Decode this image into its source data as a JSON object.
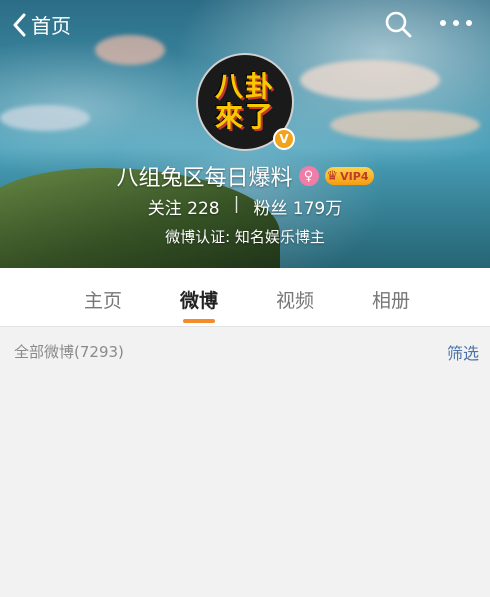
{
  "nav": {
    "back_label": "首页"
  },
  "profile": {
    "avatar_text_line1": "八卦",
    "avatar_text_line2": "來了",
    "verified_mark": "V",
    "name": "八组兔区每日爆料",
    "female_badge": "♀",
    "vip_label": "VIP4",
    "following_label": "关注",
    "following_count": "228",
    "followers_label": "粉丝",
    "followers_count": "179万",
    "certification": "微博认证: 知名娱乐博主"
  },
  "tabs": [
    {
      "label": "主页",
      "active": false
    },
    {
      "label": "微博",
      "active": true
    },
    {
      "label": "视频",
      "active": false
    },
    {
      "label": "相册",
      "active": false
    }
  ],
  "feed": {
    "all_posts_label": "全部微博(7293)",
    "filter_label": "筛选"
  },
  "colors": {
    "accent": "#f28b28",
    "link": "#4a73a8",
    "verified": "#f3a21b"
  }
}
